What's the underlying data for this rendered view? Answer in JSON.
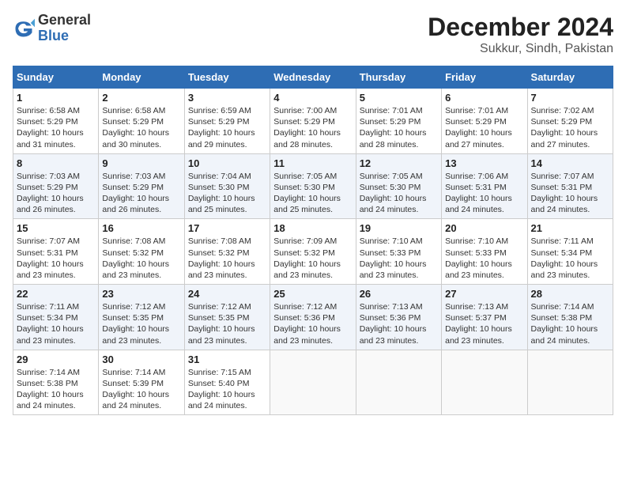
{
  "header": {
    "logo_general": "General",
    "logo_blue": "Blue",
    "title": "December 2024",
    "subtitle": "Sukkur, Sindh, Pakistan"
  },
  "days_of_week": [
    "Sunday",
    "Monday",
    "Tuesday",
    "Wednesday",
    "Thursday",
    "Friday",
    "Saturday"
  ],
  "weeks": [
    [
      {
        "day": "1",
        "sunrise": "6:58 AM",
        "sunset": "5:29 PM",
        "daylight": "10 hours and 31 minutes."
      },
      {
        "day": "2",
        "sunrise": "6:58 AM",
        "sunset": "5:29 PM",
        "daylight": "10 hours and 30 minutes."
      },
      {
        "day": "3",
        "sunrise": "6:59 AM",
        "sunset": "5:29 PM",
        "daylight": "10 hours and 29 minutes."
      },
      {
        "day": "4",
        "sunrise": "7:00 AM",
        "sunset": "5:29 PM",
        "daylight": "10 hours and 28 minutes."
      },
      {
        "day": "5",
        "sunrise": "7:01 AM",
        "sunset": "5:29 PM",
        "daylight": "10 hours and 28 minutes."
      },
      {
        "day": "6",
        "sunrise": "7:01 AM",
        "sunset": "5:29 PM",
        "daylight": "10 hours and 27 minutes."
      },
      {
        "day": "7",
        "sunrise": "7:02 AM",
        "sunset": "5:29 PM",
        "daylight": "10 hours and 27 minutes."
      }
    ],
    [
      {
        "day": "8",
        "sunrise": "7:03 AM",
        "sunset": "5:29 PM",
        "daylight": "10 hours and 26 minutes."
      },
      {
        "day": "9",
        "sunrise": "7:03 AM",
        "sunset": "5:29 PM",
        "daylight": "10 hours and 26 minutes."
      },
      {
        "day": "10",
        "sunrise": "7:04 AM",
        "sunset": "5:30 PM",
        "daylight": "10 hours and 25 minutes."
      },
      {
        "day": "11",
        "sunrise": "7:05 AM",
        "sunset": "5:30 PM",
        "daylight": "10 hours and 25 minutes."
      },
      {
        "day": "12",
        "sunrise": "7:05 AM",
        "sunset": "5:30 PM",
        "daylight": "10 hours and 24 minutes."
      },
      {
        "day": "13",
        "sunrise": "7:06 AM",
        "sunset": "5:31 PM",
        "daylight": "10 hours and 24 minutes."
      },
      {
        "day": "14",
        "sunrise": "7:07 AM",
        "sunset": "5:31 PM",
        "daylight": "10 hours and 24 minutes."
      }
    ],
    [
      {
        "day": "15",
        "sunrise": "7:07 AM",
        "sunset": "5:31 PM",
        "daylight": "10 hours and 23 minutes."
      },
      {
        "day": "16",
        "sunrise": "7:08 AM",
        "sunset": "5:32 PM",
        "daylight": "10 hours and 23 minutes."
      },
      {
        "day": "17",
        "sunrise": "7:08 AM",
        "sunset": "5:32 PM",
        "daylight": "10 hours and 23 minutes."
      },
      {
        "day": "18",
        "sunrise": "7:09 AM",
        "sunset": "5:32 PM",
        "daylight": "10 hours and 23 minutes."
      },
      {
        "day": "19",
        "sunrise": "7:10 AM",
        "sunset": "5:33 PM",
        "daylight": "10 hours and 23 minutes."
      },
      {
        "day": "20",
        "sunrise": "7:10 AM",
        "sunset": "5:33 PM",
        "daylight": "10 hours and 23 minutes."
      },
      {
        "day": "21",
        "sunrise": "7:11 AM",
        "sunset": "5:34 PM",
        "daylight": "10 hours and 23 minutes."
      }
    ],
    [
      {
        "day": "22",
        "sunrise": "7:11 AM",
        "sunset": "5:34 PM",
        "daylight": "10 hours and 23 minutes."
      },
      {
        "day": "23",
        "sunrise": "7:12 AM",
        "sunset": "5:35 PM",
        "daylight": "10 hours and 23 minutes."
      },
      {
        "day": "24",
        "sunrise": "7:12 AM",
        "sunset": "5:35 PM",
        "daylight": "10 hours and 23 minutes."
      },
      {
        "day": "25",
        "sunrise": "7:12 AM",
        "sunset": "5:36 PM",
        "daylight": "10 hours and 23 minutes."
      },
      {
        "day": "26",
        "sunrise": "7:13 AM",
        "sunset": "5:36 PM",
        "daylight": "10 hours and 23 minutes."
      },
      {
        "day": "27",
        "sunrise": "7:13 AM",
        "sunset": "5:37 PM",
        "daylight": "10 hours and 23 minutes."
      },
      {
        "day": "28",
        "sunrise": "7:14 AM",
        "sunset": "5:38 PM",
        "daylight": "10 hours and 24 minutes."
      }
    ],
    [
      {
        "day": "29",
        "sunrise": "7:14 AM",
        "sunset": "5:38 PM",
        "daylight": "10 hours and 24 minutes."
      },
      {
        "day": "30",
        "sunrise": "7:14 AM",
        "sunset": "5:39 PM",
        "daylight": "10 hours and 24 minutes."
      },
      {
        "day": "31",
        "sunrise": "7:15 AM",
        "sunset": "5:40 PM",
        "daylight": "10 hours and 24 minutes."
      },
      null,
      null,
      null,
      null
    ]
  ],
  "labels": {
    "sunrise_prefix": "Sunrise: ",
    "sunset_prefix": "Sunset: ",
    "daylight_prefix": "Daylight: "
  }
}
